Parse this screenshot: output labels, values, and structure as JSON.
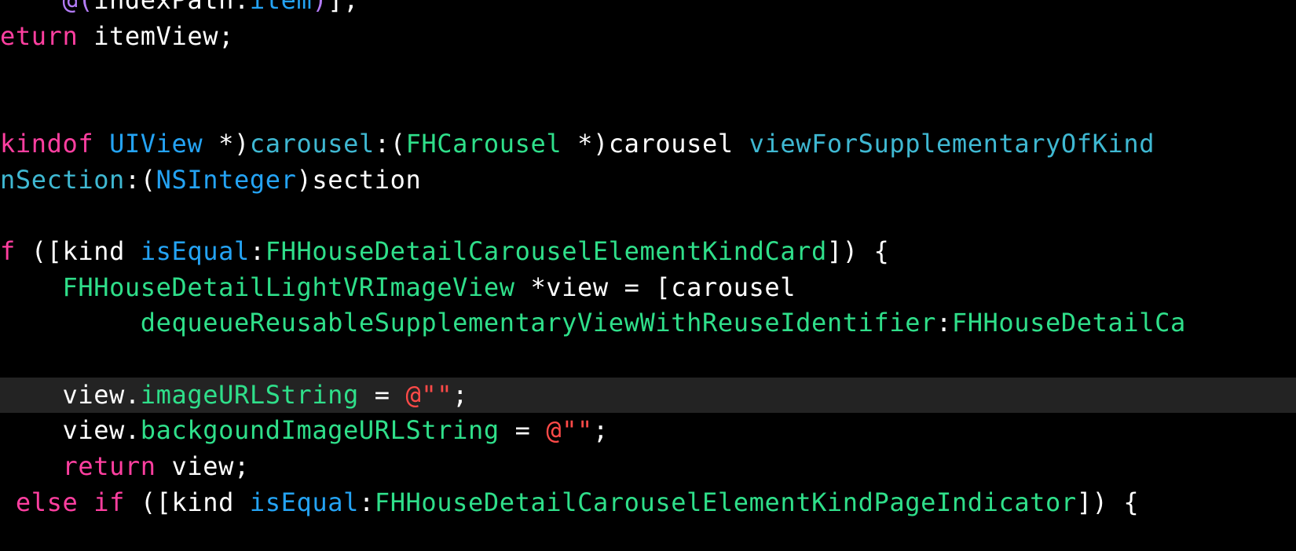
{
  "editor": {
    "colors": {
      "background": "#000000",
      "current_line": "#232323",
      "plain": "#ffffff",
      "keyword": "#ff3fa0",
      "type": "#24a3f4",
      "method": "#3fb8d2",
      "project": "#2fdf8a",
      "string": "#ff4a48",
      "macro": "#b47cf8"
    },
    "current_line_index": 11,
    "lines": [
      [
        {
          "t": "    ",
          "k": "plain"
        },
        {
          "t": "@(",
          "k": "macro"
        },
        {
          "t": "indexPath.",
          "k": "plain"
        },
        {
          "t": "item",
          "k": "type"
        },
        {
          "t": ")",
          "k": "macro"
        },
        {
          "t": "];",
          "k": "plain"
        }
      ],
      [
        {
          "t": "eturn",
          "k": "keyword"
        },
        {
          "t": " itemView;",
          "k": "plain"
        }
      ],
      [],
      [],
      [
        {
          "t": "kindof",
          "k": "keyword"
        },
        {
          "t": " ",
          "k": "plain"
        },
        {
          "t": "UIView",
          "k": "type"
        },
        {
          "t": " *)",
          "k": "plain"
        },
        {
          "t": "carousel",
          "k": "method"
        },
        {
          "t": ":(",
          "k": "plain"
        },
        {
          "t": "FHCarousel",
          "k": "project"
        },
        {
          "t": " *)carousel ",
          "k": "plain"
        },
        {
          "t": "viewForSupplementaryOfKind",
          "k": "method"
        }
      ],
      [
        {
          "t": "nSection",
          "k": "method"
        },
        {
          "t": ":(",
          "k": "plain"
        },
        {
          "t": "NSInteger",
          "k": "type"
        },
        {
          "t": ")section",
          "k": "plain"
        }
      ],
      [],
      [
        {
          "t": "f",
          "k": "keyword"
        },
        {
          "t": " ([kind ",
          "k": "plain"
        },
        {
          "t": "isEqual",
          "k": "type"
        },
        {
          "t": ":",
          "k": "plain"
        },
        {
          "t": "FHHouseDetailCarouselElementKindCard",
          "k": "project"
        },
        {
          "t": "]) {",
          "k": "plain"
        }
      ],
      [
        {
          "t": "    ",
          "k": "plain"
        },
        {
          "t": "FHHouseDetailLightVRImageView",
          "k": "project"
        },
        {
          "t": " *view = [carousel",
          "k": "plain"
        }
      ],
      [
        {
          "t": "         ",
          "k": "plain"
        },
        {
          "t": "dequeueReusableSupplementaryViewWithReuseIdentifier",
          "k": "project"
        },
        {
          "t": ":",
          "k": "plain"
        },
        {
          "t": "FHHouseDetailCa",
          "k": "project"
        }
      ],
      [],
      [
        {
          "t": "    view.",
          "k": "plain"
        },
        {
          "t": "imageURLString",
          "k": "project"
        },
        {
          "t": " = ",
          "k": "plain"
        },
        {
          "t": "@\"\"",
          "k": "string"
        },
        {
          "t": ";",
          "k": "plain"
        }
      ],
      [
        {
          "t": "    view.",
          "k": "plain"
        },
        {
          "t": "backgoundImageURLString",
          "k": "project"
        },
        {
          "t": " = ",
          "k": "plain"
        },
        {
          "t": "@\"\"",
          "k": "string"
        },
        {
          "t": ";",
          "k": "plain"
        }
      ],
      [
        {
          "t": "    ",
          "k": "plain"
        },
        {
          "t": "return",
          "k": "keyword"
        },
        {
          "t": " view;",
          "k": "plain"
        }
      ],
      [
        {
          "t": " ",
          "k": "plain"
        },
        {
          "t": "else",
          "k": "keyword"
        },
        {
          "t": " ",
          "k": "plain"
        },
        {
          "t": "if",
          "k": "keyword"
        },
        {
          "t": " ([kind ",
          "k": "plain"
        },
        {
          "t": "isEqual",
          "k": "type"
        },
        {
          "t": ":",
          "k": "plain"
        },
        {
          "t": "FHHouseDetailCarouselElementKindPageIndicator",
          "k": "project"
        },
        {
          "t": "]) {",
          "k": "plain"
        }
      ]
    ]
  }
}
